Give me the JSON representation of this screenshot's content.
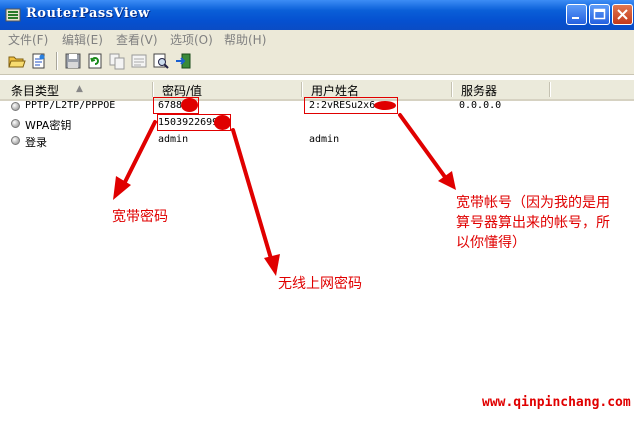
{
  "window": {
    "title": "RouterPassView",
    "controls": [
      "minimize",
      "maximize",
      "close"
    ]
  },
  "menu": [
    {
      "label": "文件(F)"
    },
    {
      "label": "编辑(E)"
    },
    {
      "label": "查看(V)"
    },
    {
      "label": "选项(O)"
    },
    {
      "label": "帮助(H)"
    }
  ],
  "toolbar": {
    "icons": [
      "open-folder-icon",
      "open-file-icon",
      "save-icon",
      "refresh-icon",
      "copy-icon",
      "properties-icon",
      "find-icon",
      "exit-icon"
    ]
  },
  "table": {
    "columns": [
      "条目类型",
      "密码/值",
      "用户姓名",
      "服务器"
    ],
    "sort_indicator": "▲",
    "rows": [
      {
        "type": "PPTP/L2TP/PPPOE",
        "value": "6788",
        "user": "2:2vRESu2x6",
        "server": "0.0.0.0"
      },
      {
        "type": "WPA密钥",
        "value": "1503922699",
        "user": "",
        "server": ""
      },
      {
        "type": "登录",
        "value": "admin",
        "user": "admin",
        "server": ""
      }
    ]
  },
  "annotations": {
    "broadband_password": "宽带密码",
    "wireless_password": "无线上网密码",
    "broadband_account_line1": "宽带帐号（因为我的是用",
    "broadband_account_line2": "算号器算出来的帐号，所",
    "broadband_account_line3": "以你懂得）",
    "annotation_color": "#e00000"
  },
  "watermark": "www.qinpinchang.com"
}
